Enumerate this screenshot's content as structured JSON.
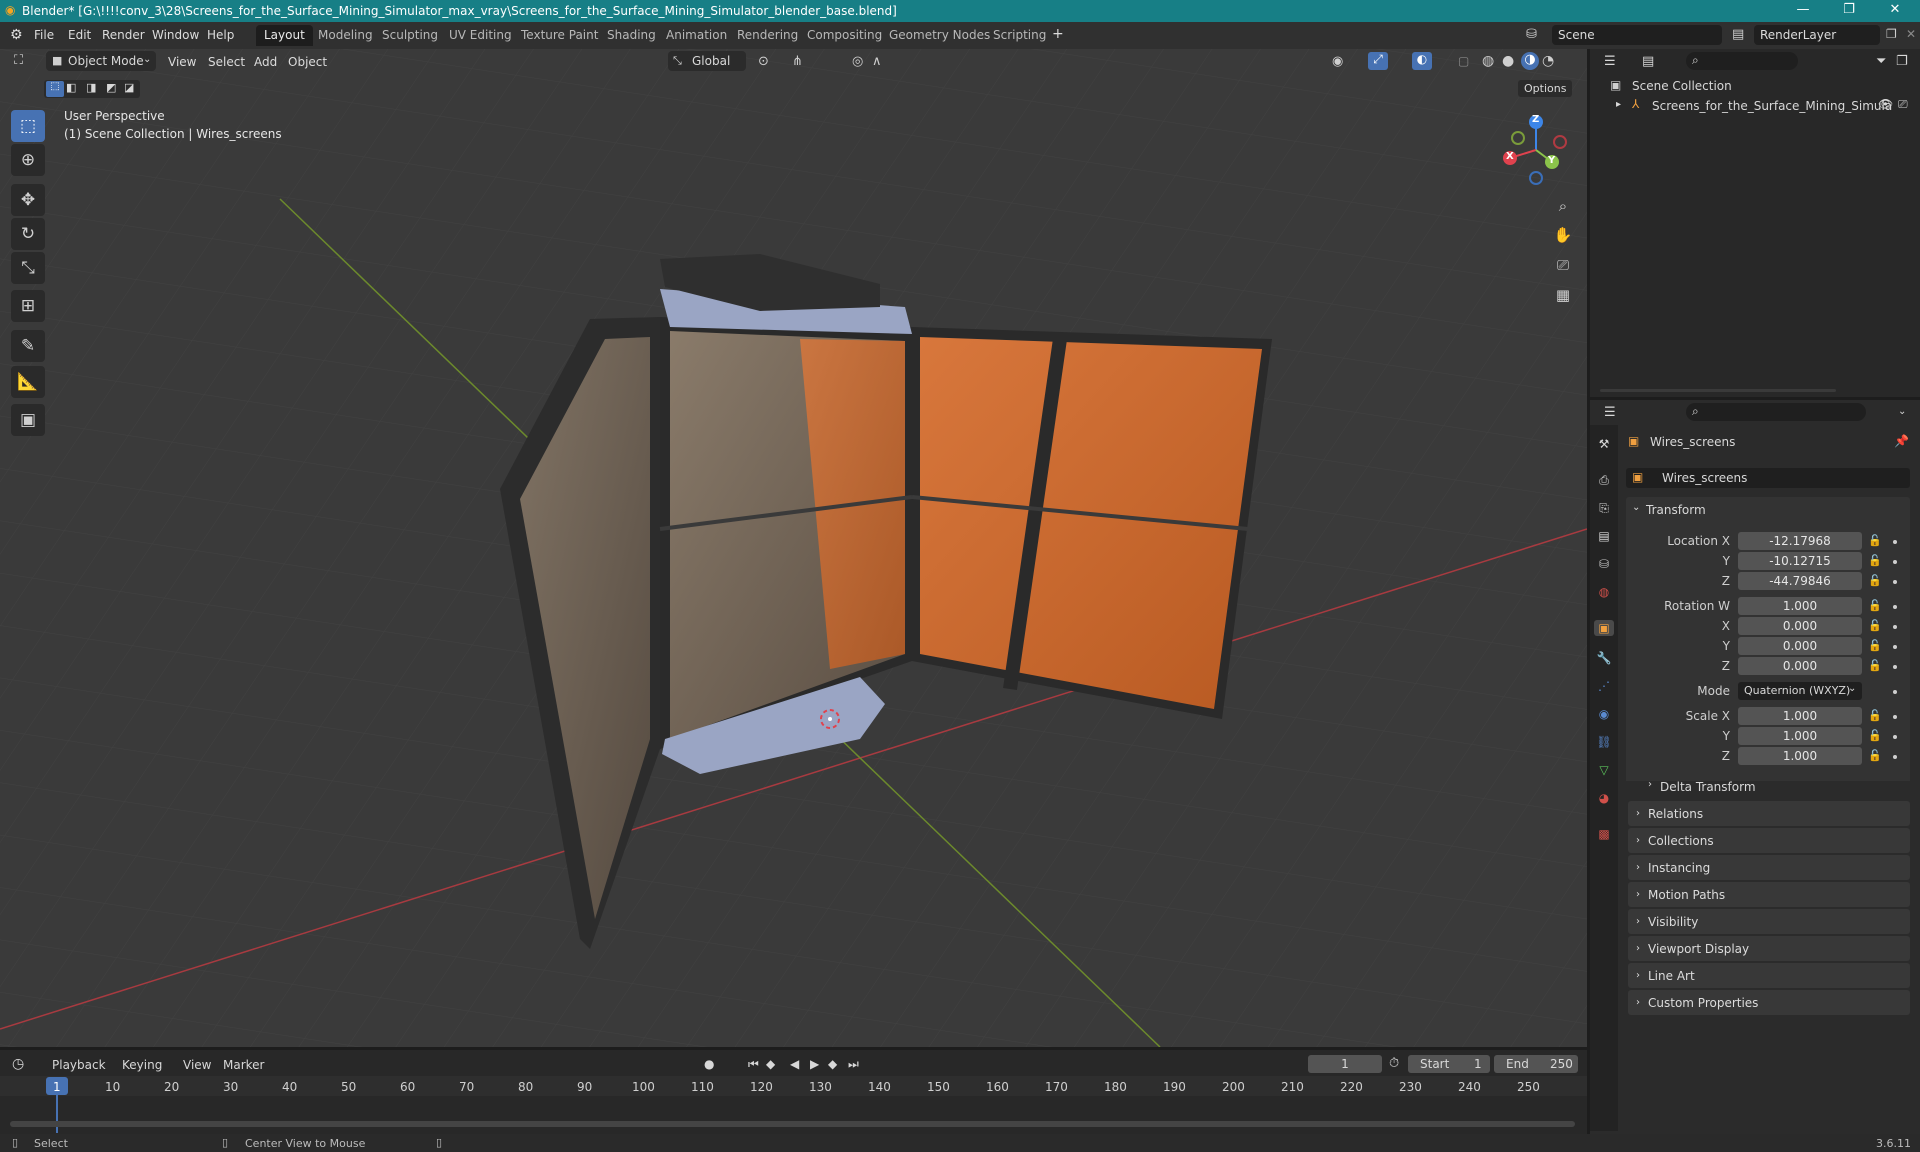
{
  "window": {
    "title": "Blender* [G:\\!!!!conv_3\\28\\Screens_for_the_Surface_Mining_Simulator_max_vray\\Screens_for_the_Surface_Mining_Simulator_blender_base.blend]",
    "minimize": "—",
    "maximize": "❐",
    "close": "✕"
  },
  "menu": [
    "File",
    "Edit",
    "Render",
    "Window",
    "Help"
  ],
  "workspaces": [
    "Layout",
    "Modeling",
    "Sculpting",
    "UV Editing",
    "Texture Paint",
    "Shading",
    "Animation",
    "Rendering",
    "Compositing",
    "Geometry Nodes",
    "Scripting"
  ],
  "workspace_add": "+",
  "scene": {
    "scene_name": "Scene",
    "render_layer": "RenderLayer"
  },
  "viewport": {
    "mode": "Object Mode",
    "menus": [
      "View",
      "Select",
      "Add",
      "Object"
    ],
    "orientation": "Global",
    "options": "Options",
    "overlay_line1": "User Perspective",
    "overlay_line2": "(1) Scene Collection | Wires_screens",
    "gizmo": {
      "x": "X",
      "y": "Y",
      "z": "Z"
    }
  },
  "outliner": {
    "collection": "Scene Collection",
    "item": "Screens_for_the_Surface_Mining_Simula"
  },
  "properties": {
    "object_name": "Wires_screens",
    "data_name": "Wires_screens",
    "transform_label": "Transform",
    "location": {
      "label": "Location X",
      "x": "-12.17968",
      "y": "-10.12715",
      "z": "-44.79846"
    },
    "rotation": {
      "label": "Rotation W",
      "w": "1.000",
      "x": "0.000",
      "y": "0.000",
      "z": "0.000"
    },
    "mode_label": "Mode",
    "mode_value": "Quaternion (WXYZ)",
    "scale": {
      "label": "Scale X",
      "x": "1.000",
      "y": "1.000",
      "z": "1.000"
    },
    "axis_y": "Y",
    "axis_z": "Z",
    "axis_x": "X",
    "delta_transform": "Delta Transform",
    "sections": [
      "Relations",
      "Collections",
      "Instancing",
      "Motion Paths",
      "Visibility",
      "Viewport Display",
      "Line Art",
      "Custom Properties"
    ]
  },
  "timeline": {
    "menus": [
      "Playback",
      "Keying",
      "View",
      "Marker"
    ],
    "current_frame": "1",
    "start_label": "Start",
    "start": "1",
    "end_label": "End",
    "end": "250",
    "ticks": [
      "1",
      "10",
      "20",
      "30",
      "40",
      "50",
      "60",
      "70",
      "80",
      "90",
      "100",
      "110",
      "120",
      "130",
      "140",
      "150",
      "160",
      "170",
      "180",
      "190",
      "200",
      "210",
      "220",
      "230",
      "240",
      "250"
    ]
  },
  "statusbar": {
    "select": "Select",
    "center": "Center View to Mouse",
    "version": "3.6.11"
  },
  "colors": {
    "accent": "#4772b3",
    "titlebar": "#177f86",
    "x_axis": "#e0424e",
    "y_axis": "#8bc34a",
    "z_axis": "#3d86e8"
  }
}
